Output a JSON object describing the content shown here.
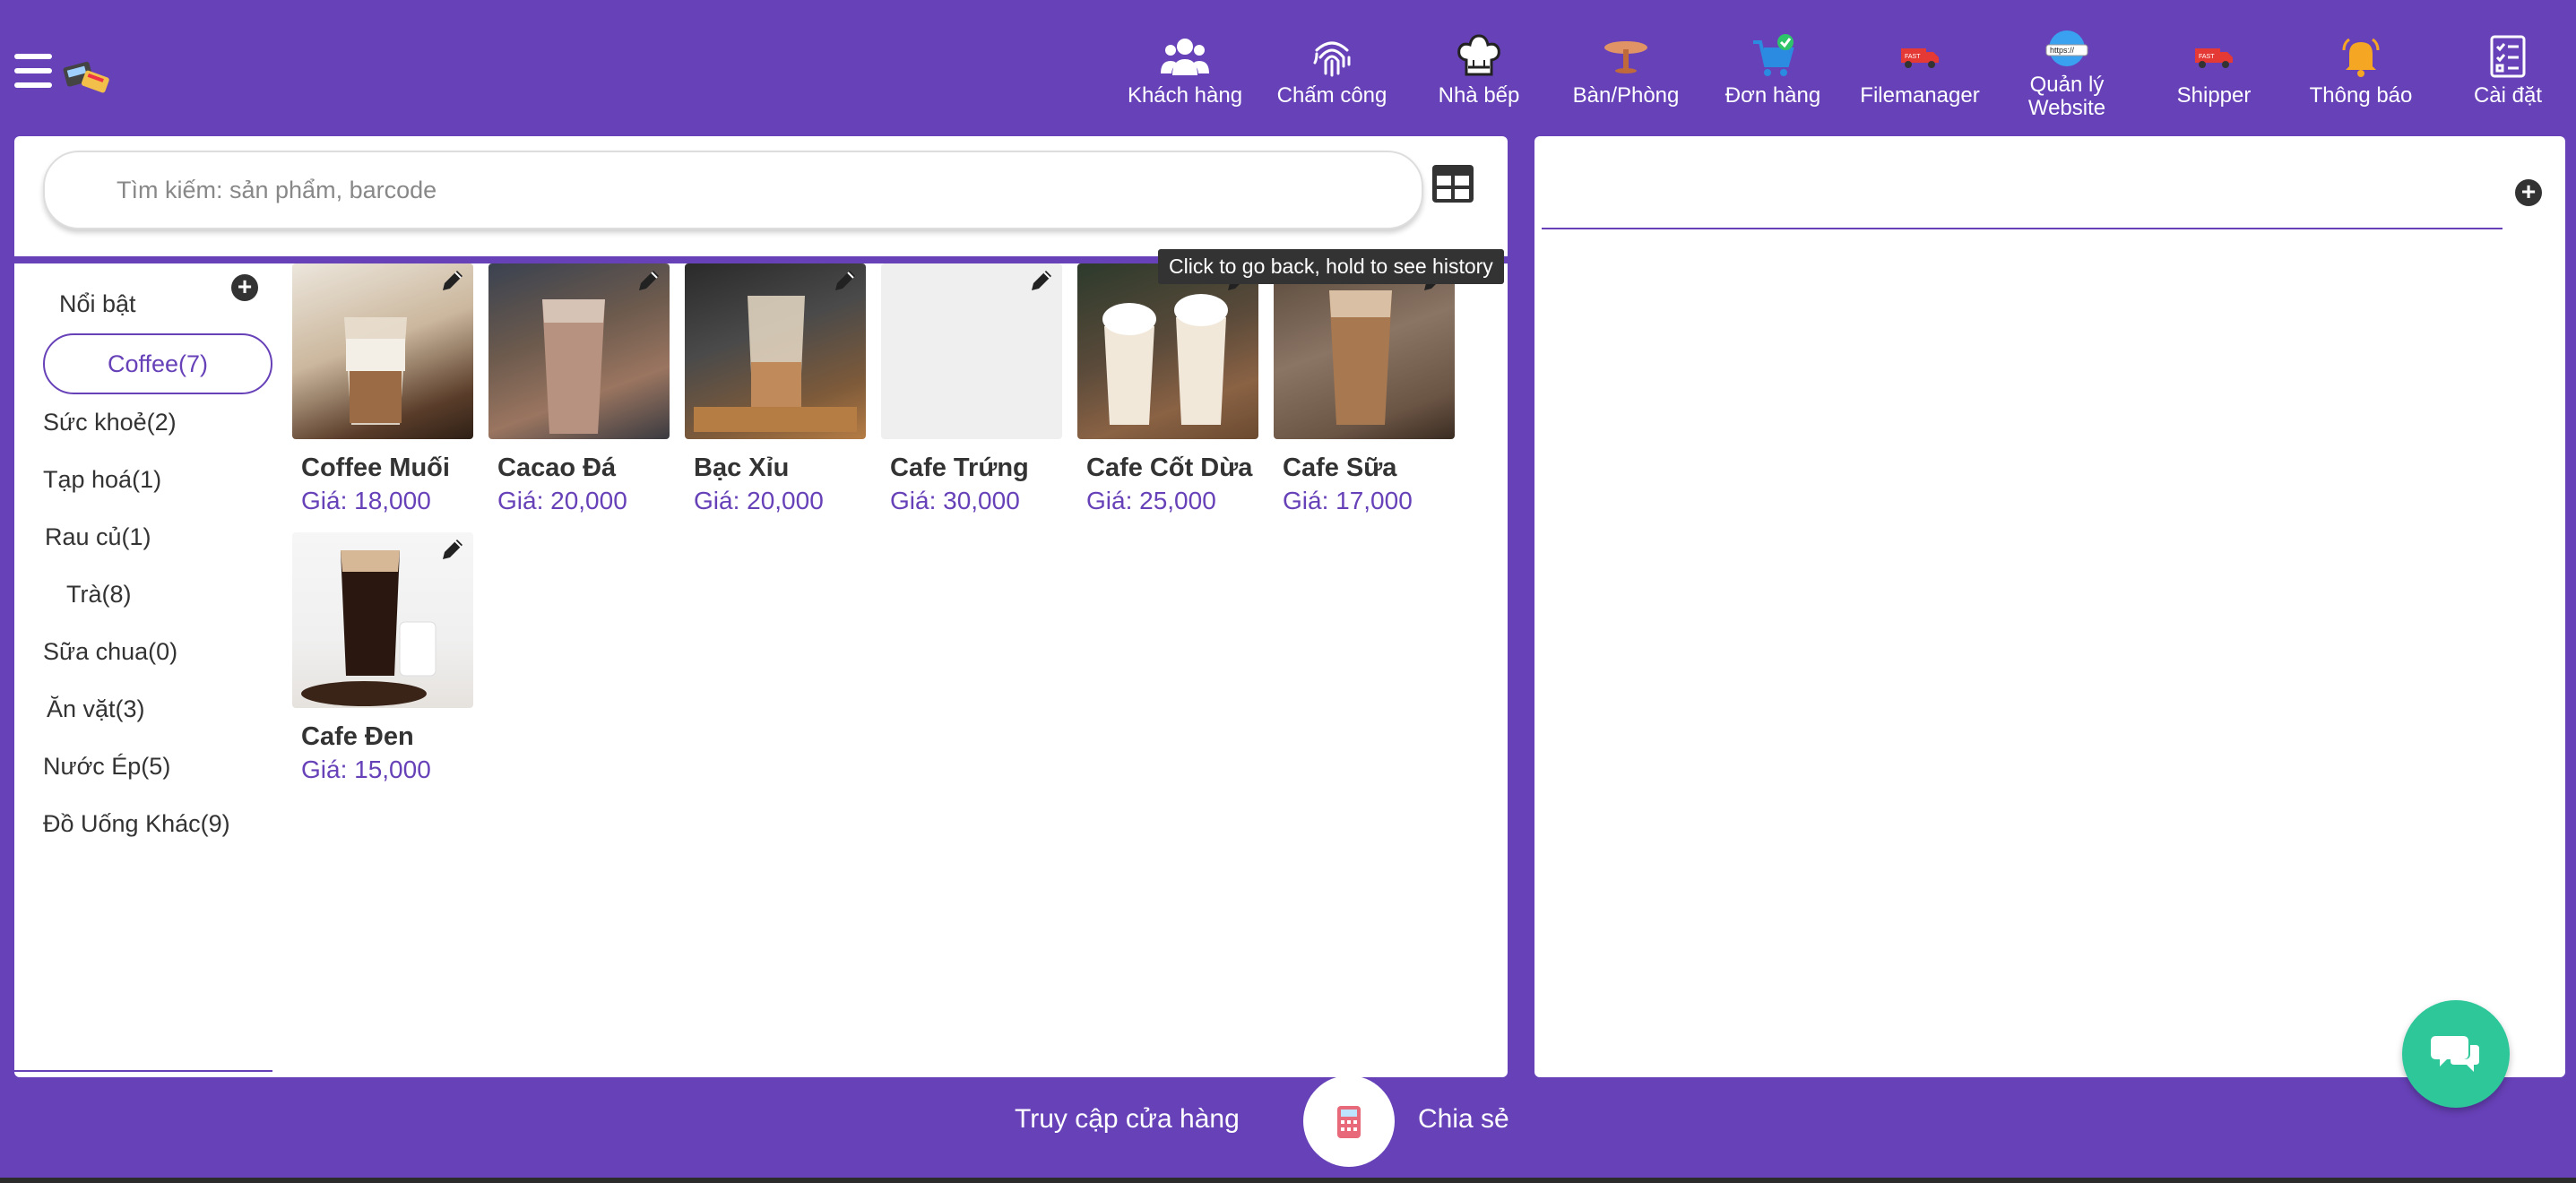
{
  "header": {
    "nav": [
      {
        "icon": "users-icon",
        "label": "Khách hàng"
      },
      {
        "icon": "fingerprint-icon",
        "label": "Chấm công"
      },
      {
        "icon": "chef-hat-icon",
        "label": "Nhà bếp"
      },
      {
        "icon": "table-icon",
        "label": "Bàn/Phòng"
      },
      {
        "icon": "cart-icon",
        "label": "Đơn hàng"
      },
      {
        "icon": "truck-icon",
        "label": "Filemanager"
      },
      {
        "icon": "globe-icon",
        "label": "Quản lý\nWebsite"
      },
      {
        "icon": "delivery-truck-icon",
        "label": "Shipper"
      },
      {
        "icon": "bell-icon",
        "label": "Thông báo"
      },
      {
        "icon": "checklist-icon",
        "label": "Cài đặt"
      }
    ]
  },
  "search": {
    "placeholder": "Tìm kiếm: sản phẩm, barcode"
  },
  "categories": {
    "items": [
      {
        "label": "Nổi bật"
      },
      {
        "label": "Coffee(7)",
        "active": true
      },
      {
        "label": "Sức khoẻ(2)"
      },
      {
        "label": "Tạp hoá(1)"
      },
      {
        "label": "Rau củ(1)"
      },
      {
        "label": "Trà(8)"
      },
      {
        "label": "Sữa chua(0)"
      },
      {
        "label": "Ăn vặt(3)"
      },
      {
        "label": "Nước Ép(5)"
      },
      {
        "label": "Đồ Uống Khác(9)"
      }
    ]
  },
  "products": [
    {
      "name": "Coffee Muối",
      "price": "Giá: 18,000"
    },
    {
      "name": "Cacao Đá",
      "price": "Giá: 20,000"
    },
    {
      "name": "Bạc Xỉu",
      "price": "Giá: 20,000"
    },
    {
      "name": "Cafe Trứng",
      "price": "Giá: 30,000"
    },
    {
      "name": "Cafe Cốt Dừa",
      "price": "Giá: 25,000"
    },
    {
      "name": "Cafe Sữa",
      "price": "Giá: 17,000"
    },
    {
      "name": "Cafe Đen",
      "price": "Giá: 15,000"
    }
  ],
  "tooltip": "Click to go back, hold to see history",
  "footer": {
    "access_label": "Truy cập cửa hàng",
    "share_label": "Chia sẻ"
  },
  "colors": {
    "brand": "#6741b8",
    "chat": "#2ec79a",
    "price": "#6741b8"
  }
}
